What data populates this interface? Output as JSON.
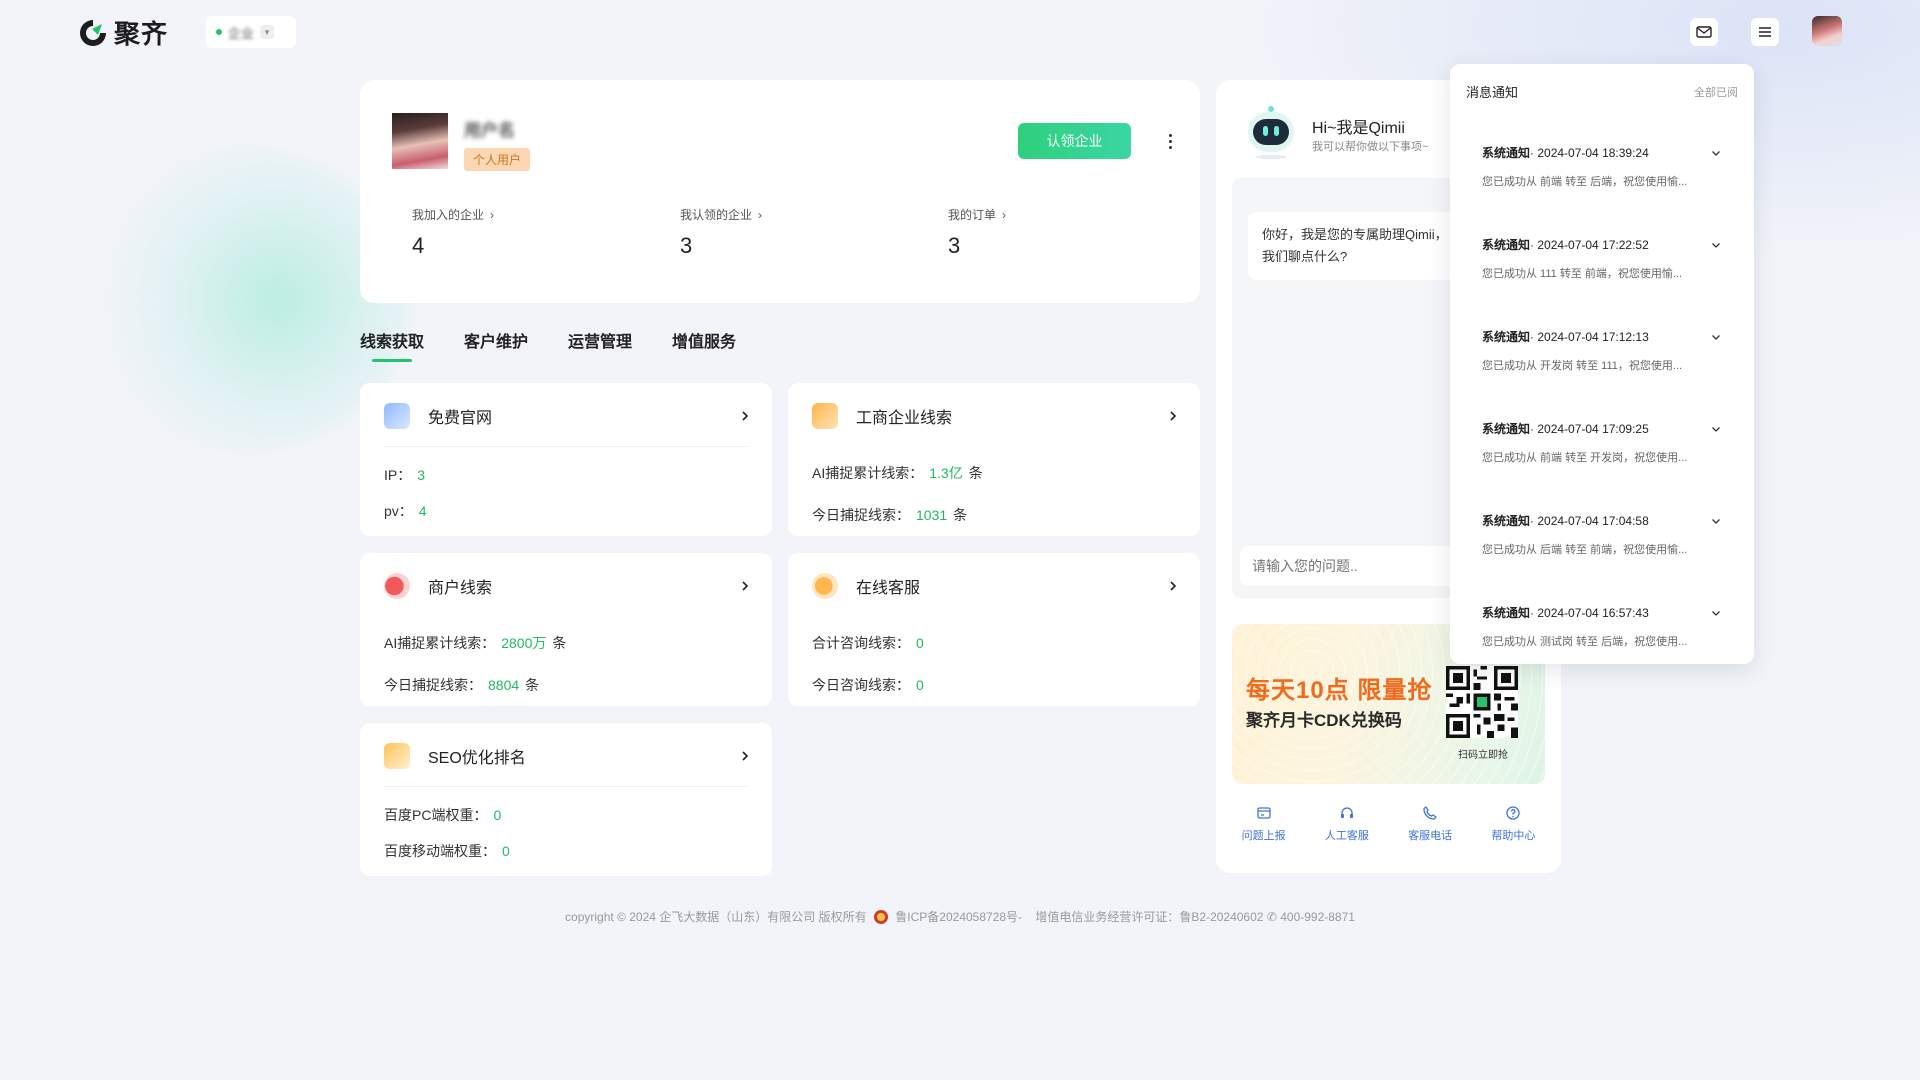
{
  "app": {
    "brand": "聚齐",
    "org_name": "企业"
  },
  "header": {
    "mail_label": "消息",
    "menu_label": "菜单"
  },
  "profile": {
    "name": "用户名",
    "badge": "个人用户",
    "claim_button": "认领企业",
    "stats": [
      {
        "label": "我加入的企业",
        "value": "4"
      },
      {
        "label": "我认领的企业",
        "value": "3"
      },
      {
        "label": "我的订单",
        "value": "3"
      }
    ]
  },
  "tabs": [
    {
      "label": "线索获取",
      "active": true
    },
    {
      "label": "客户维护",
      "active": false
    },
    {
      "label": "运营管理",
      "active": false
    },
    {
      "label": "增值服务",
      "active": false
    }
  ],
  "features": {
    "website": {
      "title": "免费官网",
      "r1_label": "IP：",
      "r1_value": "3",
      "r2_label": "pv：",
      "r2_value": "4"
    },
    "business": {
      "title": "工商企业线索",
      "r1_label": "AI捕捉累计线索：",
      "r1_value": "1.3亿",
      "r1_unit": "条",
      "r2_label": "今日捕捉线索：",
      "r2_value": "1031",
      "r2_unit": "条"
    },
    "merchant": {
      "title": "商户线索",
      "r1_label": "AI捕捉累计线索：",
      "r1_value": "2800万",
      "r1_unit": "条",
      "r2_label": "今日捕捉线索：",
      "r2_value": "8804",
      "r2_unit": "条"
    },
    "service": {
      "title": "在线客服",
      "r1_label": "合计咨询线索：",
      "r1_value": "0",
      "r2_label": "今日咨询线索：",
      "r2_value": "0"
    },
    "seo": {
      "title": "SEO优化排名",
      "r1_label": "百度PC端权重：",
      "r1_value": "0",
      "r2_label": "百度移动端权重：",
      "r2_value": "0"
    }
  },
  "assistant": {
    "title": "Hi~我是Qimii",
    "subtitle": "我可以帮你做以下事项~",
    "greeting": "你好，我是您的专属助理Qimii，我们聊点什么?",
    "input_placeholder": "请输入您的问题..",
    "promo_line1": "每天10点 限量抢",
    "promo_line2": "聚齐月卡CDK兑换码",
    "qr_caption": "扫码立即抢",
    "help": [
      {
        "label": "问题上报",
        "icon": "report-icon"
      },
      {
        "label": "人工客服",
        "icon": "headset-icon"
      },
      {
        "label": "客服电话",
        "icon": "phone-icon"
      },
      {
        "label": "帮助中心",
        "icon": "help-icon"
      }
    ]
  },
  "notifications": {
    "title": "消息通知",
    "read_all": "全部已阅",
    "items": [
      {
        "type": "系统通知",
        "time": "· 2024-07-04 18:39:24",
        "body": "您已成功从 前端 转至 后端，祝您使用愉..."
      },
      {
        "type": "系统通知",
        "time": "· 2024-07-04 17:22:52",
        "body": "您已成功从 111 转至 前端，祝您使用愉..."
      },
      {
        "type": "系统通知",
        "time": "· 2024-07-04 17:12:13",
        "body": "您已成功从 开发岗 转至 111，祝您使用..."
      },
      {
        "type": "系统通知",
        "time": "· 2024-07-04 17:09:25",
        "body": "您已成功从 前端 转至 开发岗，祝您使用..."
      },
      {
        "type": "系统通知",
        "time": "· 2024-07-04 17:04:58",
        "body": "您已成功从 后端 转至 前端，祝您使用愉..."
      },
      {
        "type": "系统通知",
        "time": "· 2024-07-04 16:57:43",
        "body": "您已成功从 测试岗 转至 后端，祝您使用..."
      }
    ]
  },
  "footer": {
    "copyright": "copyright © 2024 企飞大数据（山东）有限公司 版权所有",
    "icp": "鲁ICP备2024058728号-",
    "license": "增值电信业务经营许可证：鲁B2-20240602",
    "phone": "400-992-8871"
  },
  "colors": {
    "accent": "#24c46a",
    "promo_orange": "#f26a1b",
    "badge_bg": "#fbd7b3"
  }
}
